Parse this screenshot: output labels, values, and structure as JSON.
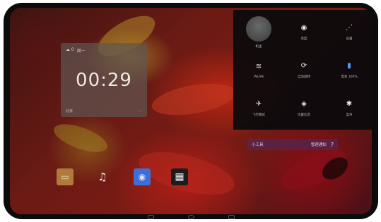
{
  "clock_widget": {
    "time": "00:29",
    "top_left_a": "☁ 0",
    "top_left_b": "周一",
    "bottom_left": "北京",
    "bottom_right": "..."
  },
  "dock": {
    "items": [
      {
        "name": "gallery-app",
        "glyph": "▭"
      },
      {
        "name": "music-app",
        "glyph": "♫"
      },
      {
        "name": "browser-app",
        "glyph": "◉"
      },
      {
        "name": "apps-app",
        "glyph": "▦"
      }
    ]
  },
  "quick_settings": {
    "tiles": [
      {
        "id": "owner",
        "glyph": "",
        "label": "机主"
      },
      {
        "id": "brightness",
        "glyph": "◉",
        "label": "亮度"
      },
      {
        "id": "settings",
        "glyph": "⋰",
        "label": "设置"
      },
      {
        "id": "wifi",
        "glyph": "≋",
        "label": "WLAN"
      },
      {
        "id": "rotate",
        "glyph": "⟳",
        "label": "自动旋转"
      },
      {
        "id": "battery",
        "glyph": "▮",
        "label": "电池 100%"
      },
      {
        "id": "airplane",
        "glyph": "✈",
        "label": "飞行模式"
      },
      {
        "id": "location",
        "glyph": "◈",
        "label": "位置信息"
      },
      {
        "id": "bluetooth",
        "glyph": "✱",
        "label": "蓝牙"
      }
    ]
  },
  "notification": {
    "left": "小工具",
    "right": "管理通知",
    "help": "?"
  },
  "colors": {
    "bezel": "#0b0b0b",
    "panel": "#0a0a0c",
    "accent_blue": "#3f6fd6"
  }
}
